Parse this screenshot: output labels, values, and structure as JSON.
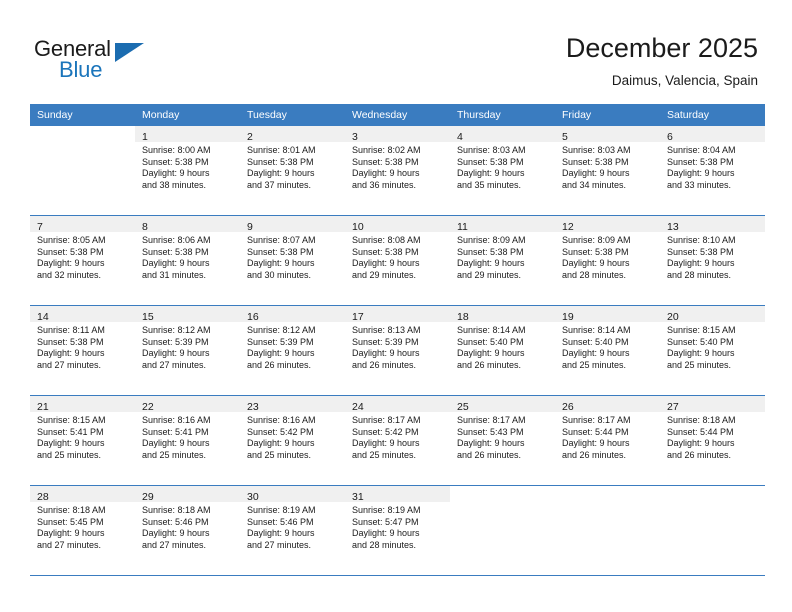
{
  "brand": {
    "name_top": "General",
    "name_bottom": "Blue"
  },
  "header": {
    "title": "December 2025",
    "subtitle": "Daimus, Valencia, Spain"
  },
  "colors": {
    "header_blue": "#3a7cc0",
    "logo_blue": "#1b75bb",
    "daynum_band": "#f0f0f0",
    "text": "#1b1b1b"
  },
  "weekdays": [
    "Sunday",
    "Monday",
    "Tuesday",
    "Wednesday",
    "Thursday",
    "Friday",
    "Saturday"
  ],
  "labels": {
    "sunrise_prefix": "Sunrise:",
    "sunset_prefix": "Sunset:",
    "daylight_prefix": "Daylight:"
  },
  "weeks": [
    [
      {
        "day": "",
        "sunrise": "",
        "sunset": "",
        "daylight_1": "",
        "daylight_2": ""
      },
      {
        "day": "1",
        "sunrise": "Sunrise: 8:00 AM",
        "sunset": "Sunset: 5:38 PM",
        "daylight_1": "Daylight: 9 hours",
        "daylight_2": "and 38 minutes."
      },
      {
        "day": "2",
        "sunrise": "Sunrise: 8:01 AM",
        "sunset": "Sunset: 5:38 PM",
        "daylight_1": "Daylight: 9 hours",
        "daylight_2": "and 37 minutes."
      },
      {
        "day": "3",
        "sunrise": "Sunrise: 8:02 AM",
        "sunset": "Sunset: 5:38 PM",
        "daylight_1": "Daylight: 9 hours",
        "daylight_2": "and 36 minutes."
      },
      {
        "day": "4",
        "sunrise": "Sunrise: 8:03 AM",
        "sunset": "Sunset: 5:38 PM",
        "daylight_1": "Daylight: 9 hours",
        "daylight_2": "and 35 minutes."
      },
      {
        "day": "5",
        "sunrise": "Sunrise: 8:03 AM",
        "sunset": "Sunset: 5:38 PM",
        "daylight_1": "Daylight: 9 hours",
        "daylight_2": "and 34 minutes."
      },
      {
        "day": "6",
        "sunrise": "Sunrise: 8:04 AM",
        "sunset": "Sunset: 5:38 PM",
        "daylight_1": "Daylight: 9 hours",
        "daylight_2": "and 33 minutes."
      }
    ],
    [
      {
        "day": "7",
        "sunrise": "Sunrise: 8:05 AM",
        "sunset": "Sunset: 5:38 PM",
        "daylight_1": "Daylight: 9 hours",
        "daylight_2": "and 32 minutes."
      },
      {
        "day": "8",
        "sunrise": "Sunrise: 8:06 AM",
        "sunset": "Sunset: 5:38 PM",
        "daylight_1": "Daylight: 9 hours",
        "daylight_2": "and 31 minutes."
      },
      {
        "day": "9",
        "sunrise": "Sunrise: 8:07 AM",
        "sunset": "Sunset: 5:38 PM",
        "daylight_1": "Daylight: 9 hours",
        "daylight_2": "and 30 minutes."
      },
      {
        "day": "10",
        "sunrise": "Sunrise: 8:08 AM",
        "sunset": "Sunset: 5:38 PM",
        "daylight_1": "Daylight: 9 hours",
        "daylight_2": "and 29 minutes."
      },
      {
        "day": "11",
        "sunrise": "Sunrise: 8:09 AM",
        "sunset": "Sunset: 5:38 PM",
        "daylight_1": "Daylight: 9 hours",
        "daylight_2": "and 29 minutes."
      },
      {
        "day": "12",
        "sunrise": "Sunrise: 8:09 AM",
        "sunset": "Sunset: 5:38 PM",
        "daylight_1": "Daylight: 9 hours",
        "daylight_2": "and 28 minutes."
      },
      {
        "day": "13",
        "sunrise": "Sunrise: 8:10 AM",
        "sunset": "Sunset: 5:38 PM",
        "daylight_1": "Daylight: 9 hours",
        "daylight_2": "and 28 minutes."
      }
    ],
    [
      {
        "day": "14",
        "sunrise": "Sunrise: 8:11 AM",
        "sunset": "Sunset: 5:38 PM",
        "daylight_1": "Daylight: 9 hours",
        "daylight_2": "and 27 minutes."
      },
      {
        "day": "15",
        "sunrise": "Sunrise: 8:12 AM",
        "sunset": "Sunset: 5:39 PM",
        "daylight_1": "Daylight: 9 hours",
        "daylight_2": "and 27 minutes."
      },
      {
        "day": "16",
        "sunrise": "Sunrise: 8:12 AM",
        "sunset": "Sunset: 5:39 PM",
        "daylight_1": "Daylight: 9 hours",
        "daylight_2": "and 26 minutes."
      },
      {
        "day": "17",
        "sunrise": "Sunrise: 8:13 AM",
        "sunset": "Sunset: 5:39 PM",
        "daylight_1": "Daylight: 9 hours",
        "daylight_2": "and 26 minutes."
      },
      {
        "day": "18",
        "sunrise": "Sunrise: 8:14 AM",
        "sunset": "Sunset: 5:40 PM",
        "daylight_1": "Daylight: 9 hours",
        "daylight_2": "and 26 minutes."
      },
      {
        "day": "19",
        "sunrise": "Sunrise: 8:14 AM",
        "sunset": "Sunset: 5:40 PM",
        "daylight_1": "Daylight: 9 hours",
        "daylight_2": "and 25 minutes."
      },
      {
        "day": "20",
        "sunrise": "Sunrise: 8:15 AM",
        "sunset": "Sunset: 5:40 PM",
        "daylight_1": "Daylight: 9 hours",
        "daylight_2": "and 25 minutes."
      }
    ],
    [
      {
        "day": "21",
        "sunrise": "Sunrise: 8:15 AM",
        "sunset": "Sunset: 5:41 PM",
        "daylight_1": "Daylight: 9 hours",
        "daylight_2": "and 25 minutes."
      },
      {
        "day": "22",
        "sunrise": "Sunrise: 8:16 AM",
        "sunset": "Sunset: 5:41 PM",
        "daylight_1": "Daylight: 9 hours",
        "daylight_2": "and 25 minutes."
      },
      {
        "day": "23",
        "sunrise": "Sunrise: 8:16 AM",
        "sunset": "Sunset: 5:42 PM",
        "daylight_1": "Daylight: 9 hours",
        "daylight_2": "and 25 minutes."
      },
      {
        "day": "24",
        "sunrise": "Sunrise: 8:17 AM",
        "sunset": "Sunset: 5:42 PM",
        "daylight_1": "Daylight: 9 hours",
        "daylight_2": "and 25 minutes."
      },
      {
        "day": "25",
        "sunrise": "Sunrise: 8:17 AM",
        "sunset": "Sunset: 5:43 PM",
        "daylight_1": "Daylight: 9 hours",
        "daylight_2": "and 26 minutes."
      },
      {
        "day": "26",
        "sunrise": "Sunrise: 8:17 AM",
        "sunset": "Sunset: 5:44 PM",
        "daylight_1": "Daylight: 9 hours",
        "daylight_2": "and 26 minutes."
      },
      {
        "day": "27",
        "sunrise": "Sunrise: 8:18 AM",
        "sunset": "Sunset: 5:44 PM",
        "daylight_1": "Daylight: 9 hours",
        "daylight_2": "and 26 minutes."
      }
    ],
    [
      {
        "day": "28",
        "sunrise": "Sunrise: 8:18 AM",
        "sunset": "Sunset: 5:45 PM",
        "daylight_1": "Daylight: 9 hours",
        "daylight_2": "and 27 minutes."
      },
      {
        "day": "29",
        "sunrise": "Sunrise: 8:18 AM",
        "sunset": "Sunset: 5:46 PM",
        "daylight_1": "Daylight: 9 hours",
        "daylight_2": "and 27 minutes."
      },
      {
        "day": "30",
        "sunrise": "Sunrise: 8:19 AM",
        "sunset": "Sunset: 5:46 PM",
        "daylight_1": "Daylight: 9 hours",
        "daylight_2": "and 27 minutes."
      },
      {
        "day": "31",
        "sunrise": "Sunrise: 8:19 AM",
        "sunset": "Sunset: 5:47 PM",
        "daylight_1": "Daylight: 9 hours",
        "daylight_2": "and 28 minutes."
      },
      {
        "day": "",
        "sunrise": "",
        "sunset": "",
        "daylight_1": "",
        "daylight_2": ""
      },
      {
        "day": "",
        "sunrise": "",
        "sunset": "",
        "daylight_1": "",
        "daylight_2": ""
      },
      {
        "day": "",
        "sunrise": "",
        "sunset": "",
        "daylight_1": "",
        "daylight_2": ""
      }
    ]
  ]
}
